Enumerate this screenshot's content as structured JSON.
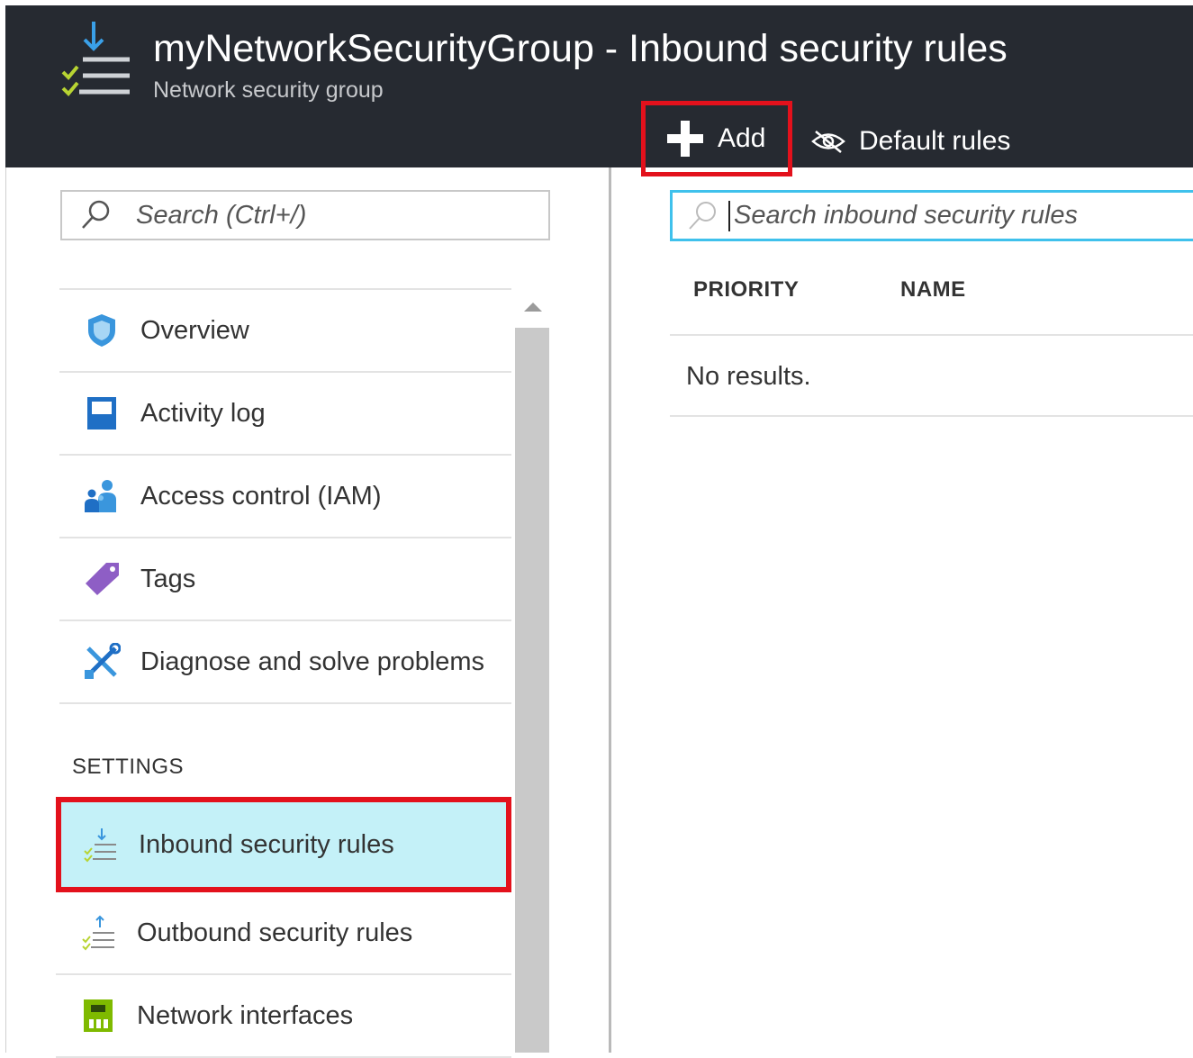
{
  "header": {
    "title": "myNetworkSecurityGroup - Inbound security rules",
    "subtitle": "Network security group",
    "icon": "inbound-rules-icon",
    "background": "#262a31"
  },
  "toolbar": {
    "add_label": "Add",
    "default_rules_label": "Default rules"
  },
  "left_panel": {
    "search_placeholder": "Search (Ctrl+/)",
    "items": [
      {
        "label": "Overview",
        "icon": "shield-icon"
      },
      {
        "label": "Activity log",
        "icon": "activity-log-icon"
      },
      {
        "label": "Access control (IAM)",
        "icon": "people-icon"
      },
      {
        "label": "Tags",
        "icon": "tag-icon"
      },
      {
        "label": "Diagnose and solve problems",
        "icon": "tools-icon"
      }
    ],
    "settings_header": "SETTINGS",
    "settings_items": [
      {
        "label": "Inbound security rules",
        "icon": "inbound-rules-icon",
        "selected": true
      },
      {
        "label": "Outbound security rules",
        "icon": "outbound-rules-icon"
      },
      {
        "label": "Network interfaces",
        "icon": "network-interface-icon"
      }
    ]
  },
  "right_panel": {
    "search_placeholder": "Search inbound security rules",
    "columns": [
      "PRIORITY",
      "NAME"
    ],
    "empty_text": "No results."
  },
  "colors": {
    "highlight_border": "#e3111c",
    "selected_bg": "#c4f1f8",
    "search_focus": "#3fc1ec"
  }
}
